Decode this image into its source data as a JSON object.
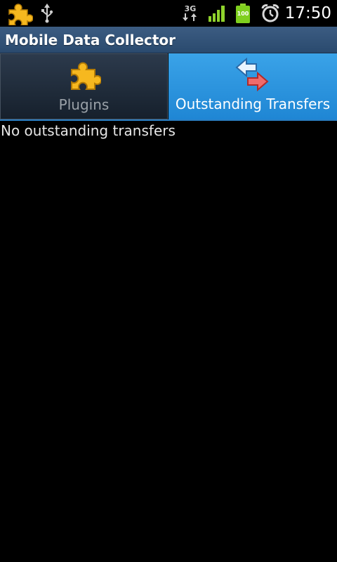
{
  "status_bar": {
    "time": "17:50",
    "network_type": "3G",
    "battery_level": "100",
    "icons": [
      "puzzle-notification-icon",
      "usb-icon",
      "3g-data-icon",
      "signal-icon",
      "battery-icon",
      "alarm-icon"
    ]
  },
  "title_bar": {
    "title": "Mobile Data Collector",
    "color": "#2f4f75"
  },
  "tabs": [
    {
      "label": "Plugins",
      "icon": "puzzle-icon",
      "selected": false
    },
    {
      "label": "Outstanding Transfers",
      "icon": "transfer-arrows-icon",
      "selected": true
    }
  ],
  "content": {
    "empty_message": "No outstanding transfers"
  },
  "colors": {
    "accent": "#2a90dc",
    "background": "#000000",
    "puzzle": "#f5b825"
  }
}
